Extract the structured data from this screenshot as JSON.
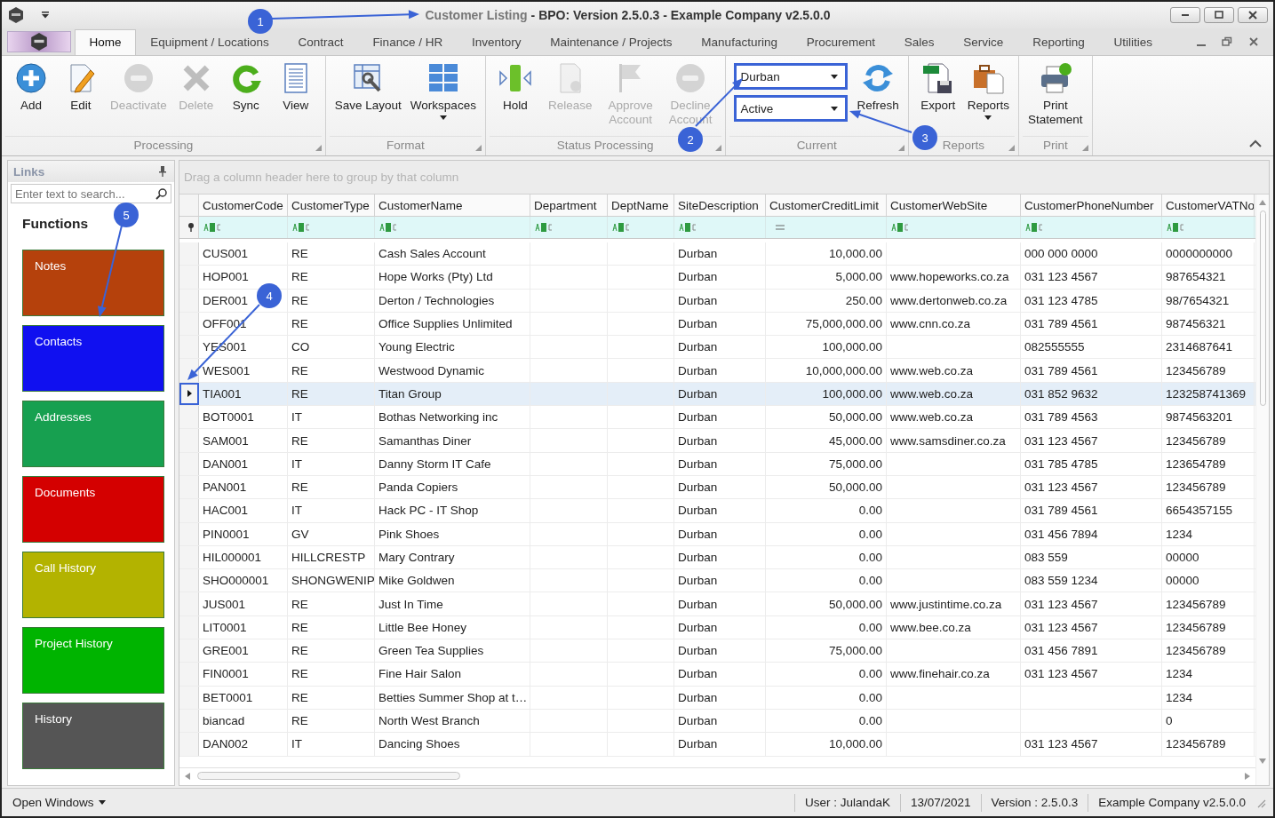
{
  "title_bar": {
    "document": "Customer Listing",
    "application": "- BPO: Version 2.5.0.3 - Example Company v2.5.0.0"
  },
  "tabs": [
    {
      "label": "Home",
      "selected": true
    },
    {
      "label": "Equipment / Locations",
      "selected": false
    },
    {
      "label": "Contract",
      "selected": false
    },
    {
      "label": "Finance / HR",
      "selected": false
    },
    {
      "label": "Inventory",
      "selected": false
    },
    {
      "label": "Maintenance / Projects",
      "selected": false
    },
    {
      "label": "Manufacturing",
      "selected": false
    },
    {
      "label": "Procurement",
      "selected": false
    },
    {
      "label": "Sales",
      "selected": false
    },
    {
      "label": "Service",
      "selected": false
    },
    {
      "label": "Reporting",
      "selected": false
    },
    {
      "label": "Utilities",
      "selected": false
    }
  ],
  "ribbon": {
    "groups": [
      {
        "label": "Processing",
        "buttons": [
          {
            "label": "Add",
            "disabled": false,
            "dropdown": false
          },
          {
            "label": "Edit",
            "disabled": false,
            "dropdown": false
          },
          {
            "label": "Deactivate",
            "disabled": true,
            "dropdown": false
          },
          {
            "label": "Delete",
            "disabled": true,
            "dropdown": false
          },
          {
            "label": "Sync",
            "disabled": false,
            "dropdown": false
          },
          {
            "label": "View",
            "disabled": false,
            "dropdown": false
          }
        ]
      },
      {
        "label": "Format",
        "buttons": [
          {
            "label": "Save Layout",
            "disabled": false,
            "dropdown": false
          },
          {
            "label": "Workspaces",
            "disabled": false,
            "dropdown": true
          }
        ]
      },
      {
        "label": "Status Processing",
        "buttons": [
          {
            "label": "Hold",
            "disabled": false,
            "dropdown": false
          },
          {
            "label": "Release",
            "disabled": true,
            "dropdown": false
          },
          {
            "label": "Approve Account",
            "disabled": true,
            "dropdown": false
          },
          {
            "label": "Decline Account",
            "disabled": true,
            "dropdown": false
          }
        ]
      },
      {
        "label": "Current",
        "combos": [
          {
            "value": "Durban",
            "highlighted": true
          },
          {
            "value": "Active",
            "highlighted": true
          }
        ],
        "buttons": [
          {
            "label": "Refresh",
            "disabled": false,
            "dropdown": false
          }
        ]
      },
      {
        "label": "Reports",
        "buttons": [
          {
            "label": "Export",
            "disabled": false,
            "dropdown": false
          },
          {
            "label": "Reports",
            "disabled": false,
            "dropdown": true
          }
        ]
      },
      {
        "label": "Print",
        "buttons": [
          {
            "label": "Print Statement",
            "disabled": false,
            "dropdown": false
          }
        ]
      }
    ]
  },
  "links_panel": {
    "title": "Links",
    "search": {
      "placeholder": "Enter text to search..."
    },
    "heading": "Functions",
    "tiles": [
      {
        "label": "Notes",
        "color": "#b5410c"
      },
      {
        "label": "Contacts",
        "color": "#1010f0"
      },
      {
        "label": "Addresses",
        "color": "#17a050"
      },
      {
        "label": "Documents",
        "color": "#d40000"
      },
      {
        "label": "Call History",
        "color": "#b3b300"
      },
      {
        "label": "Project History",
        "color": "#00b400"
      },
      {
        "label": "History",
        "color": "#555555"
      }
    ]
  },
  "grid": {
    "group_panel_hint": "Drag a column header here to group by that column",
    "columns": [
      {
        "header": "CustomerCode",
        "kind": "text"
      },
      {
        "header": "CustomerType",
        "kind": "text"
      },
      {
        "header": "CustomerName",
        "kind": "text"
      },
      {
        "header": "Department",
        "kind": "text"
      },
      {
        "header": "DeptName",
        "kind": "text"
      },
      {
        "header": "SiteDescription",
        "kind": "text"
      },
      {
        "header": "CustomerCreditLimit",
        "kind": "number"
      },
      {
        "header": "CustomerWebSite",
        "kind": "text"
      },
      {
        "header": "CustomerPhoneNumber",
        "kind": "text"
      },
      {
        "header": "CustomerVATNo",
        "kind": "text"
      }
    ],
    "rows": [
      {
        "selected": false,
        "highlighted": false,
        "cells": [
          "CUS001",
          "RE",
          "Cash Sales Account",
          null,
          null,
          "Durban",
          "10,000.00",
          null,
          "000 000 0000",
          "0000000000"
        ]
      },
      {
        "selected": false,
        "highlighted": false,
        "cells": [
          "HOP001",
          "RE",
          "Hope Works (Pty) Ltd",
          null,
          null,
          "Durban",
          "5,000.00",
          "www.hopeworks.co.za",
          "031 123 4567",
          "987654321"
        ]
      },
      {
        "selected": false,
        "highlighted": false,
        "cells": [
          "DER001",
          "RE",
          "Derton / Technologies",
          null,
          null,
          "Durban",
          "250.00",
          "www.dertonweb.co.za",
          "031 123 4785",
          "98/7654321"
        ]
      },
      {
        "selected": false,
        "highlighted": false,
        "cells": [
          "OFF001",
          "RE",
          "Office Supplies Unlimited",
          null,
          null,
          "Durban",
          "75,000,000.00",
          "www.cnn.co.za",
          "031 789 4561",
          "987456321"
        ]
      },
      {
        "selected": false,
        "highlighted": false,
        "cells": [
          "YES001",
          "CO",
          "Young Electric",
          null,
          null,
          "Durban",
          "100,000.00",
          null,
          "082555555",
          "2314687641"
        ]
      },
      {
        "selected": false,
        "highlighted": false,
        "cells": [
          "WES001",
          "RE",
          "Westwood Dynamic",
          null,
          null,
          "Durban",
          "10,000,000.00",
          "www.web.co.za",
          "031 789 4561",
          "123456789"
        ]
      },
      {
        "selected": true,
        "highlighted": true,
        "cells": [
          "TIA001",
          "RE",
          "Titan Group",
          null,
          null,
          "Durban",
          "100,000.00",
          "www.web.co.za",
          "031 852 9632",
          "123258741369"
        ]
      },
      {
        "selected": false,
        "highlighted": false,
        "cells": [
          "BOT0001",
          "IT",
          "Bothas Networking inc",
          null,
          null,
          "Durban",
          "50,000.00",
          "www.web.co.za",
          "031 789 4563",
          "9874563201"
        ]
      },
      {
        "selected": false,
        "highlighted": false,
        "cells": [
          "SAM001",
          "RE",
          "Samanthas Diner",
          null,
          null,
          "Durban",
          "45,000.00",
          "www.samsdiner.co.za",
          "031 123 4567",
          "123456789"
        ]
      },
      {
        "selected": false,
        "highlighted": false,
        "cells": [
          "DAN001",
          "IT",
          "Danny Storm IT Cafe",
          null,
          null,
          "Durban",
          "75,000.00",
          null,
          "031 785 4785",
          "123654789"
        ]
      },
      {
        "selected": false,
        "highlighted": false,
        "cells": [
          "PAN001",
          "RE",
          "Panda Copiers",
          null,
          null,
          "Durban",
          "50,000.00",
          null,
          "031 123 4567",
          "123456789"
        ]
      },
      {
        "selected": false,
        "highlighted": false,
        "cells": [
          "HAC001",
          "IT",
          "Hack PC - IT Shop",
          null,
          null,
          "Durban",
          "0.00",
          null,
          "031 789 4561",
          "6654357155"
        ]
      },
      {
        "selected": false,
        "highlighted": false,
        "cells": [
          "PIN0001",
          "GV",
          "Pink Shoes",
          null,
          null,
          "Durban",
          "0.00",
          null,
          "031 456 7894",
          "1234"
        ]
      },
      {
        "selected": false,
        "highlighted": false,
        "cells": [
          "HIL000001",
          "HILLCRESTP",
          "Mary Contrary",
          null,
          null,
          "Durban",
          "0.00",
          null,
          "083 559",
          "00000"
        ]
      },
      {
        "selected": false,
        "highlighted": false,
        "cells": [
          "SHO000001",
          "SHONGWENIP",
          "Mike Goldwen",
          null,
          null,
          "Durban",
          "0.00",
          null,
          "083 559 1234",
          "00000"
        ]
      },
      {
        "selected": false,
        "highlighted": false,
        "cells": [
          "JUS001",
          "RE",
          "Just In Time",
          null,
          null,
          "Durban",
          "50,000.00",
          "www.justintime.co.za",
          "031 123 4567",
          "123456789"
        ]
      },
      {
        "selected": false,
        "highlighted": false,
        "cells": [
          "LIT0001",
          "RE",
          "Little Bee Honey",
          null,
          null,
          "Durban",
          "0.00",
          "www.bee.co.za",
          "031 123 4567",
          "123456789"
        ]
      },
      {
        "selected": false,
        "highlighted": false,
        "cells": [
          "GRE001",
          "RE",
          "Green Tea Supplies",
          null,
          null,
          "Durban",
          "75,000.00",
          null,
          "031 456 7891",
          "123456789"
        ]
      },
      {
        "selected": false,
        "highlighted": false,
        "cells": [
          "FIN0001",
          "RE",
          "Fine Hair Salon",
          null,
          null,
          "Durban",
          "0.00",
          "www.finehair.co.za",
          "031 123 4567",
          "1234"
        ]
      },
      {
        "selected": false,
        "highlighted": false,
        "cells": [
          "BET0001",
          "RE",
          "Betties Summer Shop at t…",
          null,
          null,
          "Durban",
          "0.00",
          null,
          null,
          "1234"
        ]
      },
      {
        "selected": false,
        "highlighted": false,
        "cells": [
          "biancad",
          "RE",
          "North West Branch",
          null,
          null,
          "Durban",
          "0.00",
          null,
          null,
          "0"
        ]
      },
      {
        "selected": false,
        "highlighted": false,
        "cells": [
          "DAN002",
          "IT",
          "Dancing Shoes",
          null,
          null,
          "Durban",
          "10,000.00",
          null,
          "031 123 4567",
          "123456789"
        ]
      }
    ]
  },
  "status_bar": {
    "open_windows": "Open Windows",
    "user": "User : JulandaK",
    "date": "13/07/2021",
    "version": "Version : 2.5.0.3",
    "company": "Example Company v2.5.0.0"
  },
  "callouts": [
    {
      "number": "1"
    },
    {
      "number": "2"
    },
    {
      "number": "3"
    },
    {
      "number": "4"
    },
    {
      "number": "5"
    }
  ]
}
